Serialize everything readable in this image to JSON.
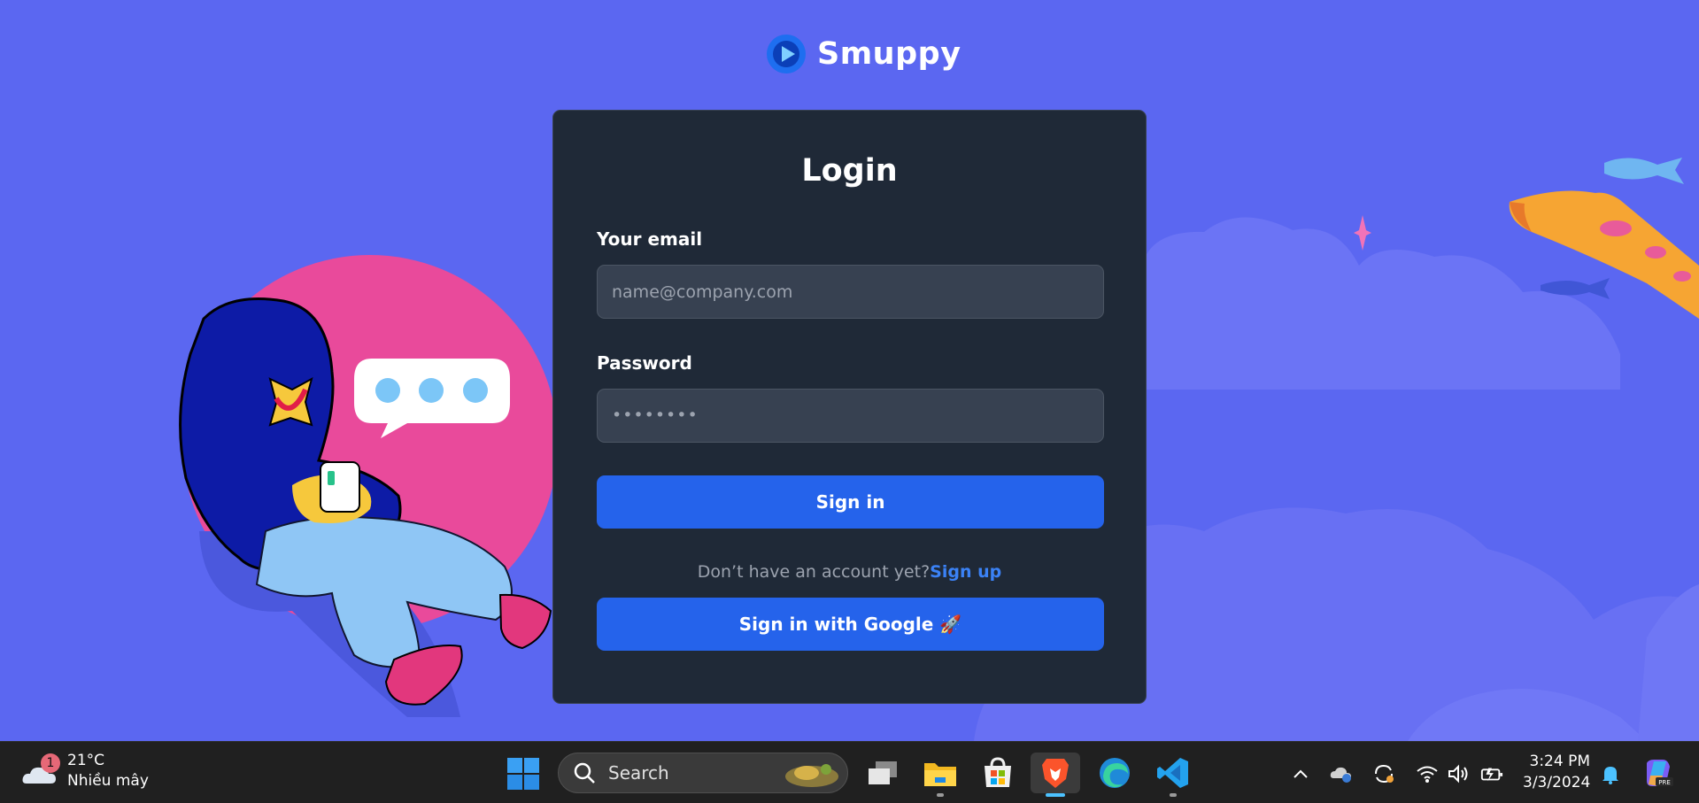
{
  "brand": {
    "name": "Smuppy"
  },
  "login": {
    "title": "Login",
    "email_label": "Your email",
    "email_placeholder": "name@company.com",
    "password_label": "Password",
    "password_value": "••••••••",
    "sign_in_label": "Sign in",
    "no_account_text": "Don’t have an account yet?",
    "sign_up_label": "Sign up",
    "google_label": "Sign in with Google 🚀"
  },
  "colors": {
    "background": "#5b67f1",
    "card": "#1f2937",
    "input": "#374151",
    "button": "#2563eb",
    "link": "#3b82f6"
  },
  "taskbar": {
    "weather": {
      "badge": "1",
      "temp": "21°C",
      "desc": "Nhiều mây",
      "icon": "cloud-icon"
    },
    "search_label": "Search",
    "apps": [
      "windows-start-icon",
      "task-view-icon",
      "file-explorer-icon",
      "microsoft-store-icon",
      "brave-browser-icon",
      "edge-browser-icon",
      "vscode-icon"
    ],
    "tray": [
      "chevron-up-icon",
      "onedrive-icon",
      "sync-icon",
      "wifi-icon",
      "volume-icon",
      "battery-icon"
    ],
    "time": "3:24 PM",
    "date": "3/3/2024"
  }
}
